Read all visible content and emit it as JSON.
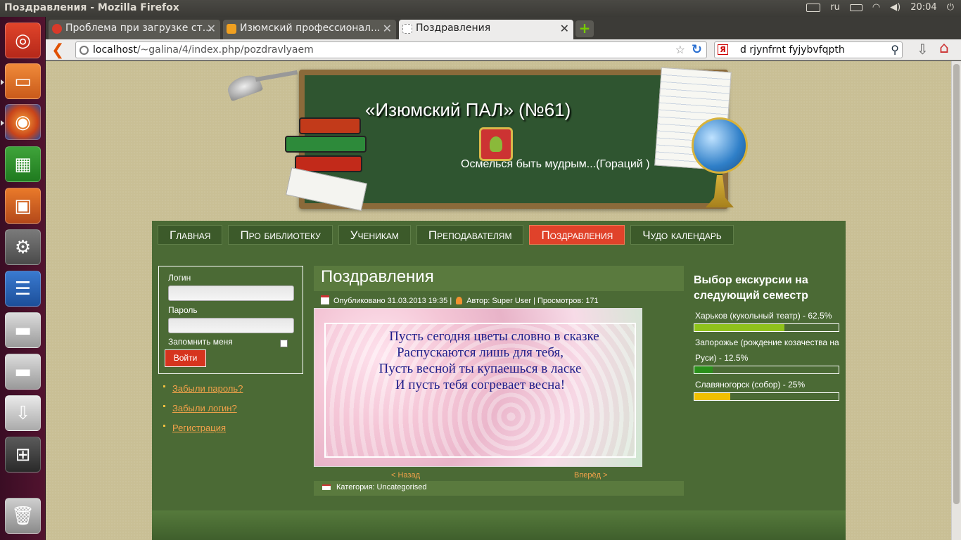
{
  "window": {
    "title": "Поздравления - Mozilla Firefox"
  },
  "tray": {
    "keyboard_layout": "ru",
    "clock": "20:04"
  },
  "launcher": {
    "items": [
      {
        "icon": "ubuntu-dash-icon"
      },
      {
        "icon": "files-folder-icon"
      },
      {
        "icon": "firefox-icon"
      },
      {
        "icon": "spreadsheet-icon"
      },
      {
        "icon": "presentation-icon"
      },
      {
        "icon": "settings-icon"
      },
      {
        "icon": "writer-document-icon"
      },
      {
        "icon": "disk-drive-icon"
      },
      {
        "icon": "disk-drive-icon"
      },
      {
        "icon": "usb-drive-icon"
      },
      {
        "icon": "workspace-switcher-icon"
      },
      {
        "icon": "trash-icon"
      }
    ]
  },
  "tabs": [
    {
      "label": "Проблема при загрузке ст...",
      "icon_color": "#d83a2a"
    },
    {
      "label": "Изюмский профессионал...",
      "icon_color": "#f0a020"
    },
    {
      "label": "Поздравления",
      "icon_color": "#ffffff"
    }
  ],
  "navbar": {
    "url_host": "localhost",
    "url_path": "/~galina/4/index.php/pozdravlyaem",
    "search_value": "d rjynfrnt fyjybvfqpth",
    "search_engine_badge": "Я"
  },
  "header": {
    "site_title": "«Изюмский ПАЛ» (№61)",
    "slogan": "Осмелься быть мудрым...(Гораций )"
  },
  "menu": [
    {
      "label": "Главная",
      "active": false
    },
    {
      "label": "Про библиотеку",
      "active": false
    },
    {
      "label": "Ученикам",
      "active": false
    },
    {
      "label": "Преподавателям",
      "active": false
    },
    {
      "label": "Поздравления",
      "active": true
    },
    {
      "label": "Чудо календарь",
      "active": false
    }
  ],
  "login": {
    "login_label": "Логин",
    "password_label": "Пароль",
    "remember_label": "Запомнить меня",
    "submit_label": "Войти",
    "links": [
      "Забыли пароль?",
      "Забыли логин?",
      "Регистрация"
    ]
  },
  "article": {
    "title": "Поздравления",
    "published": "Опубликовано 31.03.2013 19:35 |",
    "author_views": "Автор: Super User | Просмотров: 171",
    "poem": [
      "Пусть сегодня цветы словно в сказке",
      "Распускаются лишь для тебя,",
      "Пусть весной ты купаешься в ласке",
      "И пусть тебя согревает весна!"
    ],
    "prev": "< Назад",
    "next": "Вперёд >",
    "category": "Категория: Uncategorised"
  },
  "poll": {
    "title": "Выбор екскурсии на следующий семестр",
    "options": [
      {
        "label": "Харьков (кукольный театр) - 62.5%",
        "percent": 62.5,
        "color": "#8fc21b"
      },
      {
        "label": "Запорожье (рождение козачества на Руси) - 12.5%",
        "percent": 12.5,
        "color": "#2a8f1a"
      },
      {
        "label": "Славяногорск (собор) - 25%",
        "percent": 25,
        "color": "#f0c000"
      }
    ]
  }
}
